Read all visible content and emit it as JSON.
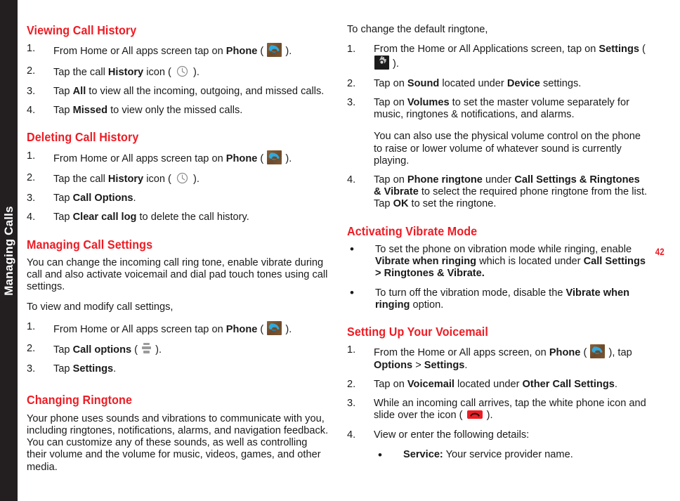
{
  "edge_tab": {
    "label": "Managing Calls"
  },
  "page_number": "42",
  "colors": {
    "heading_red": "#ED1C24",
    "edge_tab_black": "#231f20",
    "body_text": "#1a1a1a",
    "phone_icon_blue": "#2EA9DE",
    "phone_icon_brown": "#7d5733",
    "gear_icon_gray": "#b9b9b9",
    "menu_icon_gray": "#9a9a9a",
    "endcall_red": "#ED1C24"
  },
  "left_column": {
    "sections": [
      {
        "heading": "Viewing Call History",
        "items": [
          {
            "number": "1.",
            "text": "From Home or All apps screen tap on Phone (  )."
          },
          {
            "number": "2.",
            "text": "Tap the call History icon (  )."
          },
          {
            "number": "3.",
            "text": "Tap All to view all the incoming, outgoing, and missed calls."
          },
          {
            "number": "4.",
            "text": "Tap Missed to view only the missed calls."
          }
        ]
      },
      {
        "heading": "Deleting Call History",
        "items": [
          {
            "number": "1.",
            "text": "From Home or All apps screen tap on Phone (  )."
          },
          {
            "number": "2.",
            "text": "Tap the call History icon (  )."
          },
          {
            "number": "3.",
            "text": "Tap Call Options."
          },
          {
            "number": "4.",
            "text": "Tap Clear call log to delete the call history."
          }
        ]
      },
      {
        "heading": "Managing Call Settings",
        "paragraphs": [
          "You can change the incoming call ring tone, enable vibrate during call and also activate voicemail and dial pad touch tones using call settings.",
          "To view and modify call settings,"
        ],
        "items": [
          {
            "number": "1.",
            "text": "From Home or All apps screen tap on Phone (  )."
          },
          {
            "number": "2.",
            "text": "Tap Call options (  )."
          },
          {
            "number": "3.",
            "text": "Tap Settings."
          }
        ]
      },
      {
        "heading": "Changing Ringtone",
        "paragraphs": [
          "Your phone uses sounds and vibrations to communicate with you, including ringtones, notifications, alarms, and navigation feedback. You can customize any of these sounds, as well as controlling their volume and the volume for music, videos, games, and other media."
        ]
      }
    ]
  },
  "right_column": {
    "intro": "To change the default ringtone,",
    "ringtone_steps": [
      {
        "number": "1.",
        "text": "From the Home or All Applications screen, tap on Settings (  )."
      },
      {
        "number": "2.",
        "text": "Tap on Sound located under Device settings."
      },
      {
        "number": "3.",
        "text": "Tap on Volumes to set the master volume separately for music, ringtones & notifications, and alarms.",
        "continuation": "You can also use the physical volume control on the phone to raise or lower volume of whatever sound is currently playing."
      },
      {
        "number": "4.",
        "text": "Tap on Phone ringtone under Call Settings & Ringtones & Vibrate to select the required phone ringtone from the list. Tap OK to set the ringtone."
      }
    ],
    "sections": [
      {
        "heading": "Activating Vibrate Mode",
        "bullets": [
          {
            "marker": "•",
            "text": "To set the phone on vibration mode while ringing, enable Vibrate when ringing which is located under Call Settings > Ringtones & Vibrate."
          },
          {
            "marker": "•",
            "text": "To turn off the vibration mode, disable the Vibrate when ringing option."
          }
        ]
      },
      {
        "heading": "Setting Up Your Voicemail",
        "items": [
          {
            "number": "1.",
            "text": "From the Home or All apps screen, on Phone (  ), tap Options > Settings."
          },
          {
            "number": "2.",
            "text": "Tap on Voicemail located under Other Call Settings."
          },
          {
            "number": "3.",
            "text": "While an incoming call arrives, tap the white phone icon and slide over the icon (  )."
          },
          {
            "number": "4.",
            "text": "View or enter the following details:",
            "sub_bullets": [
              {
                "marker": "•",
                "label": "Service:",
                "text": " Your service provider name."
              }
            ]
          }
        ]
      }
    ]
  },
  "icons": {
    "phone_app": "phone-app-icon",
    "call_history": "clock-history-icon",
    "settings_gear": "gear-settings-icon",
    "call_options_menu": "menu-bars-icon",
    "end_call": "end-call-icon"
  }
}
